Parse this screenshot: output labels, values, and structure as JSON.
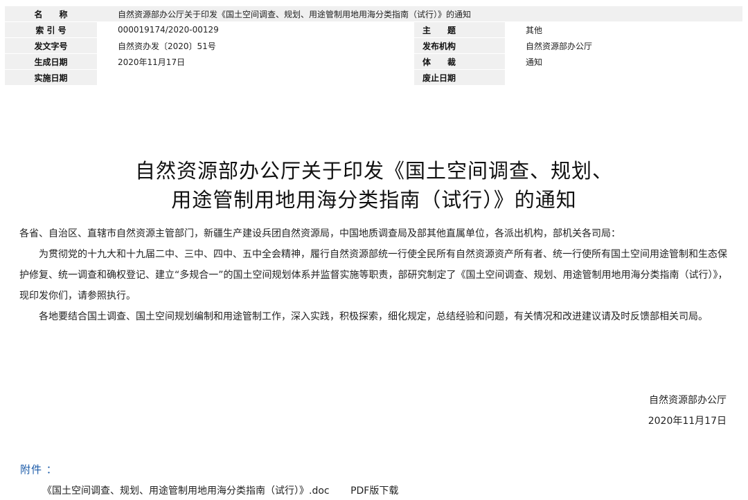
{
  "meta": {
    "name_label": "名　　称",
    "name_value": "自然资源部办公厅关于印发《国土空间调查、规划、用途管制用地用海分类指南（试行）》的通知",
    "index_label": "索 引 号",
    "index_value": "000019174/2020-00129",
    "topic_label": "主　　题",
    "topic_value": "其他",
    "docno_label": "发文字号",
    "docno_value": "自然资办发〔2020〕51号",
    "publisher_label": "发布机构",
    "publisher_value": "自然资源部办公厅",
    "created_label": "生成日期",
    "created_value": "2020年11月17日",
    "genre_label": "体　　裁",
    "genre_value": "通知",
    "effective_label": "实施日期",
    "effective_value": "",
    "expire_label": "废止日期",
    "expire_value": ""
  },
  "title": {
    "line1": "自然资源部办公厅关于印发《国土空间调查、规划、",
    "line2": "用途管制用地用海分类指南（试行）》的通知"
  },
  "body": {
    "salutation": "各省、自治区、直辖市自然资源主管部门，新疆生产建设兵团自然资源局，中国地质调查局及部其他直属单位，各派出机构，部机关各司局：",
    "para1": "为贯彻党的十九大和十九届二中、三中、四中、五中全会精神，履行自然资源部统一行使全民所有自然资源资产所有者、统一行使所有国土空间用途管制和生态保护修复、统一调查和确权登记、建立“多规合一”的国土空间规划体系并监督实施等职责，部研究制定了《国土空间调查、规划、用途管制用地用海分类指南（试行）》，现印发你们，请参照执行。",
    "para2": "各地要结合国土调查、国土空间规划编制和用途管制工作，深入实践，积极探索，细化规定，总结经验和问题，有关情况和改进建议请及时反馈部相关司局。"
  },
  "signature": {
    "org": "自然资源部办公厅",
    "date": "2020年11月17日"
  },
  "attachments": {
    "label": "附件 ：",
    "doc_link": "《国土空间调查、规划、用途管制用地用海分类指南（试行）》.doc",
    "pdf_link": "PDF版下载"
  },
  "colors": {
    "label_bg": "#f0f0f0",
    "attach_label": "#1a5aa8"
  }
}
